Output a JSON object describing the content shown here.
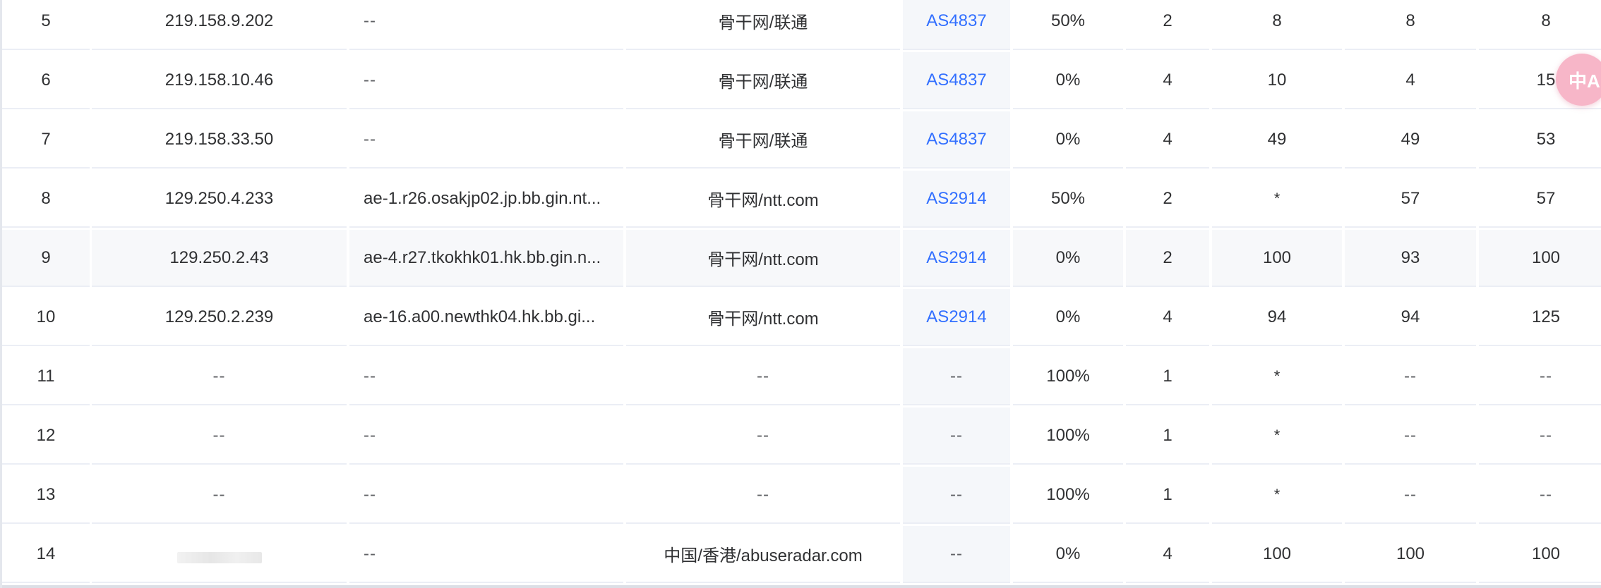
{
  "colors": {
    "link": "#3370ff",
    "highlight_row": "#f7f8fa",
    "asn_column": "#f5f7fa",
    "translate_button": "#f7b6c8"
  },
  "translate_button": {
    "glyph": "中A",
    "icon": "translate-icon"
  },
  "rows": [
    {
      "hop": "5",
      "ip": "219.158.9.202",
      "hostname": "--",
      "location": "骨干网/联通",
      "asn": "AS4837",
      "loss": "50%",
      "sent": "2",
      "last": "8",
      "avg": "8",
      "worst": "8"
    },
    {
      "hop": "6",
      "ip": "219.158.10.46",
      "hostname": "--",
      "location": "骨干网/联通",
      "asn": "AS4837",
      "loss": "0%",
      "sent": "4",
      "last": "10",
      "avg": "4",
      "worst": "15"
    },
    {
      "hop": "7",
      "ip": "219.158.33.50",
      "hostname": "--",
      "location": "骨干网/联通",
      "asn": "AS4837",
      "loss": "0%",
      "sent": "4",
      "last": "49",
      "avg": "49",
      "worst": "53"
    },
    {
      "hop": "8",
      "ip": "129.250.4.233",
      "hostname": "ae-1.r26.osakjp02.jp.bb.gin.nt...",
      "location": "骨干网/ntt.com",
      "asn": "AS2914",
      "loss": "50%",
      "sent": "2",
      "last": "*",
      "avg": "57",
      "worst": "57"
    },
    {
      "hop": "9",
      "ip": "129.250.2.43",
      "hostname": "ae-4.r27.tkokhk01.hk.bb.gin.n...",
      "location": "骨干网/ntt.com",
      "asn": "AS2914",
      "loss": "0%",
      "sent": "2",
      "last": "100",
      "avg": "93",
      "worst": "100"
    },
    {
      "hop": "10",
      "ip": "129.250.2.239",
      "hostname": "ae-16.a00.newthk04.hk.bb.gi...",
      "location": "骨干网/ntt.com",
      "asn": "AS2914",
      "loss": "0%",
      "sent": "4",
      "last": "94",
      "avg": "94",
      "worst": "125"
    },
    {
      "hop": "11",
      "ip": "--",
      "hostname": "--",
      "location": "--",
      "asn": "--",
      "loss": "100%",
      "sent": "1",
      "last": "*",
      "avg": "--",
      "worst": "--"
    },
    {
      "hop": "12",
      "ip": "--",
      "hostname": "--",
      "location": "--",
      "asn": "--",
      "loss": "100%",
      "sent": "1",
      "last": "*",
      "avg": "--",
      "worst": "--"
    },
    {
      "hop": "13",
      "ip": "--",
      "hostname": "--",
      "location": "--",
      "asn": "--",
      "loss": "100%",
      "sent": "1",
      "last": "*",
      "avg": "--",
      "worst": "--"
    },
    {
      "hop": "14",
      "ip": "",
      "hostname": "--",
      "location": "中国/香港/abuseradar.com",
      "asn": "--",
      "loss": "0%",
      "sent": "4",
      "last": "100",
      "avg": "100",
      "worst": "100"
    }
  ]
}
